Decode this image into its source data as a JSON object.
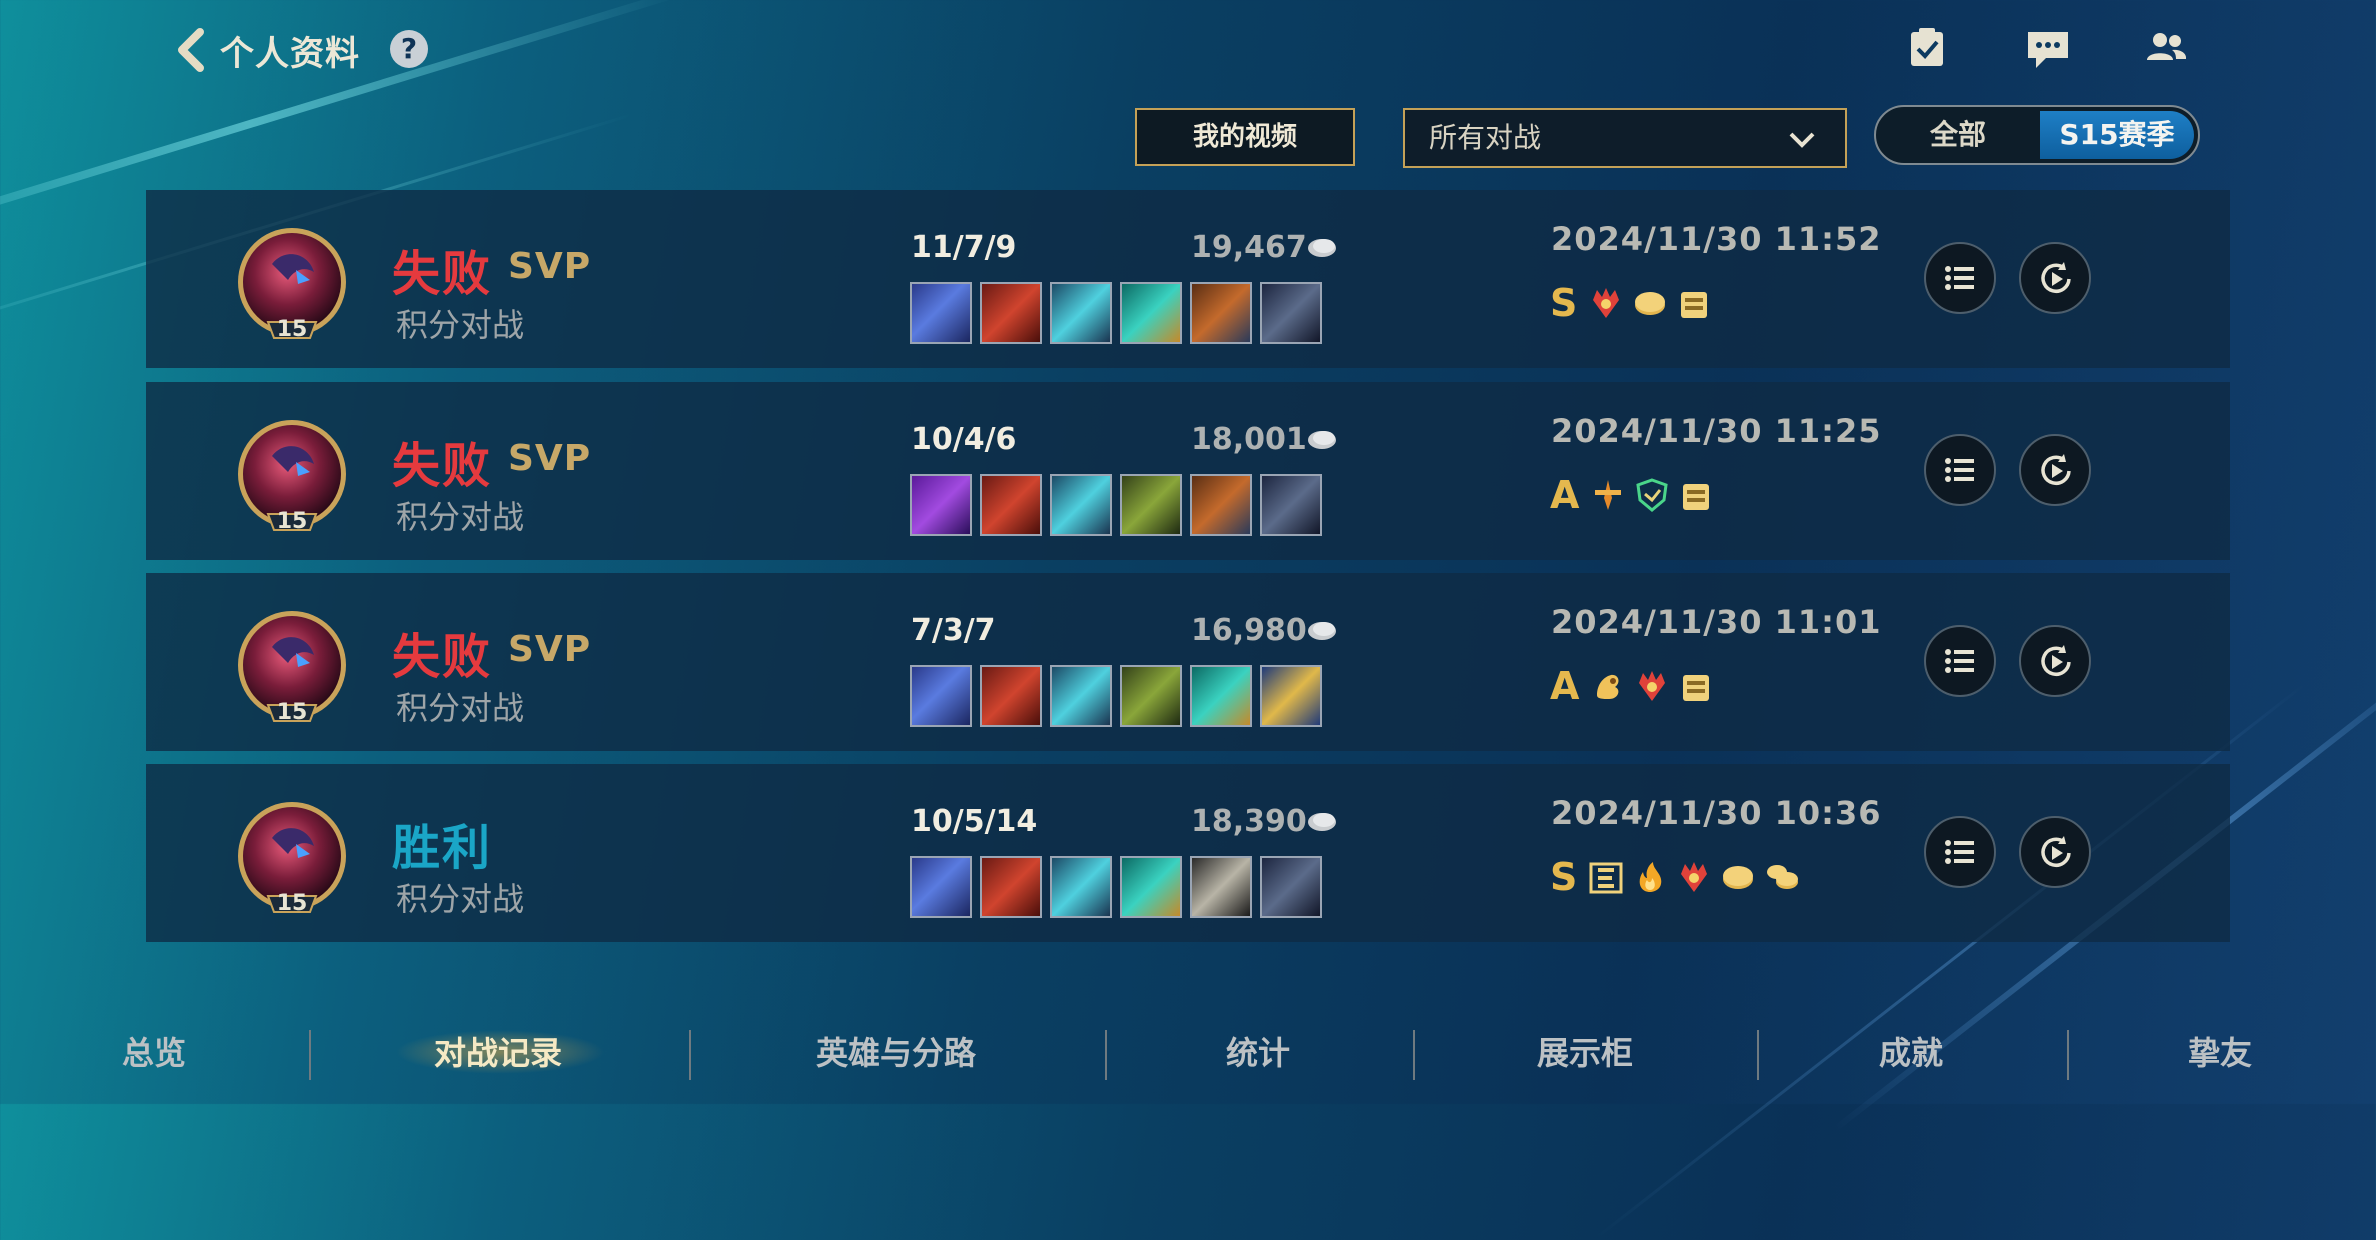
{
  "header": {
    "title": "个人资料",
    "help": "?"
  },
  "top_icons": [
    "tasks-icon",
    "chat-icon",
    "friends-icon"
  ],
  "controls": {
    "video_button": "我的视频",
    "filter_selected": "所有对战",
    "season_all": "全部",
    "season_current": "S15赛季"
  },
  "champion_level": "15",
  "matches": [
    {
      "result": "失败",
      "outcome": "loss",
      "svp": "SVP",
      "mode": "积分对战",
      "kda": "11/7/9",
      "gold": "19,467",
      "date": "2024/11/30 11:52",
      "grade": "S",
      "items": [
        "blue",
        "red",
        "cyan",
        "teal",
        "orange",
        "dark"
      ],
      "badges": [
        "red-demon",
        "gold-coin",
        "gold-chest"
      ]
    },
    {
      "result": "失败",
      "outcome": "loss",
      "svp": "SVP",
      "mode": "积分对战",
      "kda": "10/4/6",
      "gold": "18,001",
      "date": "2024/11/30 11:25",
      "grade": "A",
      "items": [
        "purple",
        "red",
        "cyan",
        "olive",
        "orange",
        "dark"
      ],
      "badges": [
        "orange-sword",
        "green-shield",
        "gold-chest"
      ]
    },
    {
      "result": "失败",
      "outcome": "loss",
      "svp": "SVP",
      "mode": "积分对战",
      "kda": "7/3/7",
      "gold": "16,980",
      "date": "2024/11/30 11:01",
      "grade": "A",
      "items": [
        "blue",
        "red",
        "cyan",
        "olive",
        "teal",
        "gold"
      ],
      "badges": [
        "gold-hand",
        "red-demon",
        "gold-chest"
      ]
    },
    {
      "result": "胜利",
      "outcome": "win",
      "svp": "",
      "mode": "积分对战",
      "kda": "10/5/14",
      "gold": "18,390",
      "date": "2024/11/30 10:36",
      "grade": "S",
      "items": [
        "blue",
        "red",
        "cyan",
        "teal",
        "grey",
        "dark"
      ],
      "badges": [
        "gold-three",
        "flame",
        "red-demon",
        "gold-coin",
        "gold-coins"
      ]
    }
  ],
  "tabs": [
    "总览",
    "对战记录",
    "英雄与分路",
    "统计",
    "展示柜",
    "成就",
    "挚友"
  ],
  "active_tab": 1,
  "colors": {
    "loss": "#e53a3e",
    "win": "#1aa6c7",
    "gold_accent": "#c4a157",
    "season_active": "#1e7fc6"
  }
}
